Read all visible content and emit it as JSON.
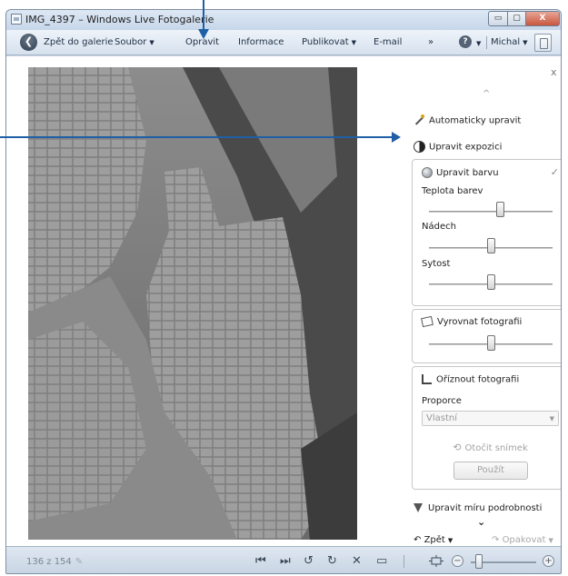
{
  "window": {
    "title": "IMG_4397 – Windows Live Fotogalerie",
    "controls": {
      "minimize": "▭",
      "maximize": "▢",
      "close": "X"
    }
  },
  "menubar": {
    "back_label": "Zpět do galerie",
    "items": [
      {
        "label": "Soubor",
        "has_dropdown": true
      },
      {
        "label": "Opravit",
        "has_dropdown": false
      },
      {
        "label": "Informace",
        "has_dropdown": false
      },
      {
        "label": "Publikovat",
        "has_dropdown": true
      },
      {
        "label": "E-mail",
        "has_dropdown": false
      }
    ],
    "overflow": "»",
    "help": "?",
    "user": "Michal"
  },
  "panel": {
    "close": "x",
    "scroll_up": "^",
    "auto_fix": "Automaticky upravit",
    "exposure": "Upravit expozici",
    "color": {
      "title": "Upravit barvu",
      "check": "✓",
      "sliders": [
        {
          "label": "Teplota barev",
          "value": 0.57
        },
        {
          "label": "Nádech",
          "value": 0.5
        },
        {
          "label": "Sytost",
          "value": 0.5
        }
      ]
    },
    "straighten": {
      "title": "Vyrovnat fotografii",
      "value": 0.5
    },
    "crop": {
      "title": "Oříznout fotografii",
      "proportion_label": "Proporce",
      "proportion_value": "Vlastní",
      "rotate": "Otočit snímek",
      "apply": "Použít"
    },
    "detail": "Upravit míru podrobnosti",
    "more": "⌄",
    "undo": "Zpět",
    "redo": "Opakovat"
  },
  "statusbar": {
    "dimensions": "136 z 154",
    "zoom_value": 0.12
  },
  "colors": {
    "annotation": "#1f5fa6",
    "window_frame": "#c9d7e8",
    "close_button": "#c8573e"
  }
}
